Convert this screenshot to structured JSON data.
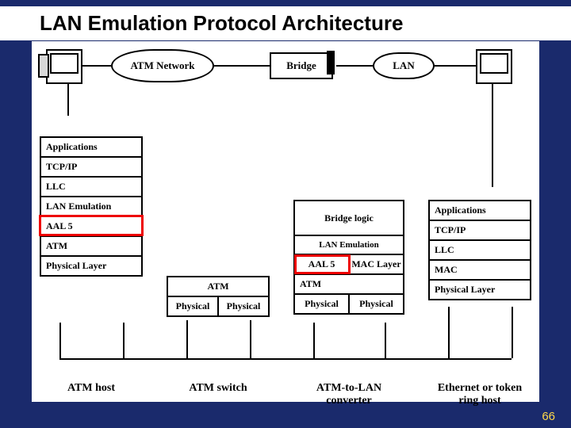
{
  "page": {
    "number": "66"
  },
  "title": "LAN Emulation Protocol Architecture",
  "top": {
    "atm_network": "ATM Network",
    "bridge": "Bridge",
    "lan": "LAN"
  },
  "stacks": {
    "atm_host": {
      "label": "ATM host",
      "layers": [
        "Applications",
        "TCP/IP",
        "LLC",
        "LAN Emulation",
        "AAL 5",
        "ATM",
        "Physical Layer"
      ],
      "highlight": "AAL 5"
    },
    "atm_switch": {
      "label": "ATM switch",
      "layers": [
        {
          "text": "ATM",
          "center": true
        },
        {
          "split": [
            "Physical",
            "Physical"
          ]
        }
      ]
    },
    "converter": {
      "label": "ATM-to-LAN converter",
      "layers": [
        {
          "text": "Bridge logic",
          "center": true,
          "tall": true
        },
        {
          "text": "LAN Emulation",
          "center": true
        },
        {
          "split_mixed": [
            {
              "t": "AAL 5",
              "hl": true
            },
            {
              "t": "MAC Layer"
            }
          ]
        },
        {
          "text": "ATM",
          "center": false
        },
        {
          "split": [
            "Physical",
            "Physical"
          ]
        }
      ],
      "highlight": "AAL 5"
    },
    "eth_host": {
      "label": "Ethernet or token ring host",
      "layers": [
        "Applications",
        "TCP/IP",
        "LLC",
        "MAC",
        "Physical Layer"
      ]
    }
  }
}
